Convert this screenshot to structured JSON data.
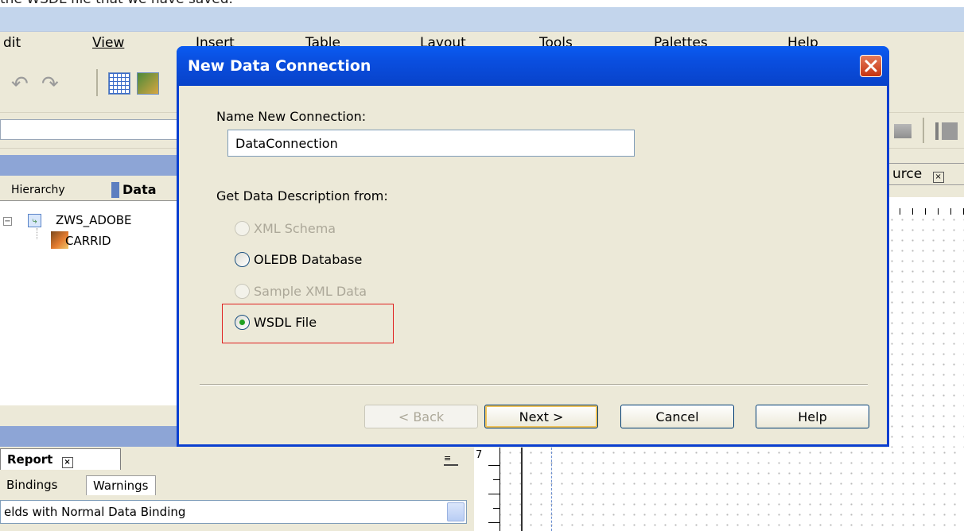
{
  "caption": "the WSDL file that we have saved.",
  "menu": [
    "dit",
    "View",
    "Insert",
    "Table",
    "Layout",
    "Tools",
    "Palettes",
    "Help"
  ],
  "left_panel": {
    "tabs": [
      "Hierarchy",
      "Data"
    ],
    "tree": [
      {
        "label": "ZWS_ADOBE",
        "icon": "schema-icon"
      },
      {
        "label": "CARRID",
        "icon": "field-icon"
      }
    ]
  },
  "bottom_panel": {
    "report_tab": "Report",
    "tabs": [
      "Bindings",
      "Warnings"
    ],
    "filter_value": "elds with Normal Data Binding"
  },
  "design_area": {
    "tab_label": "urce",
    "ruler_mark": "7"
  },
  "dialog": {
    "title": "New Data Connection",
    "name_label": "Name New Connection:",
    "name_value": "DataConnection",
    "source_label": "Get Data Description from:",
    "options": [
      {
        "label": "XML Schema",
        "enabled": false,
        "selected": false
      },
      {
        "label": "OLEDB Database",
        "enabled": true,
        "selected": false
      },
      {
        "label": "Sample XML Data",
        "enabled": false,
        "selected": false
      },
      {
        "label": "WSDL File",
        "enabled": true,
        "selected": true
      }
    ],
    "buttons": {
      "back": "< Back",
      "next": "Next >",
      "cancel": "Cancel",
      "help": "Help"
    }
  },
  "colors": {
    "titlebar": "#0a4fe0",
    "highlight_box": "#e0201f",
    "panel_header": "#8da5d6"
  }
}
